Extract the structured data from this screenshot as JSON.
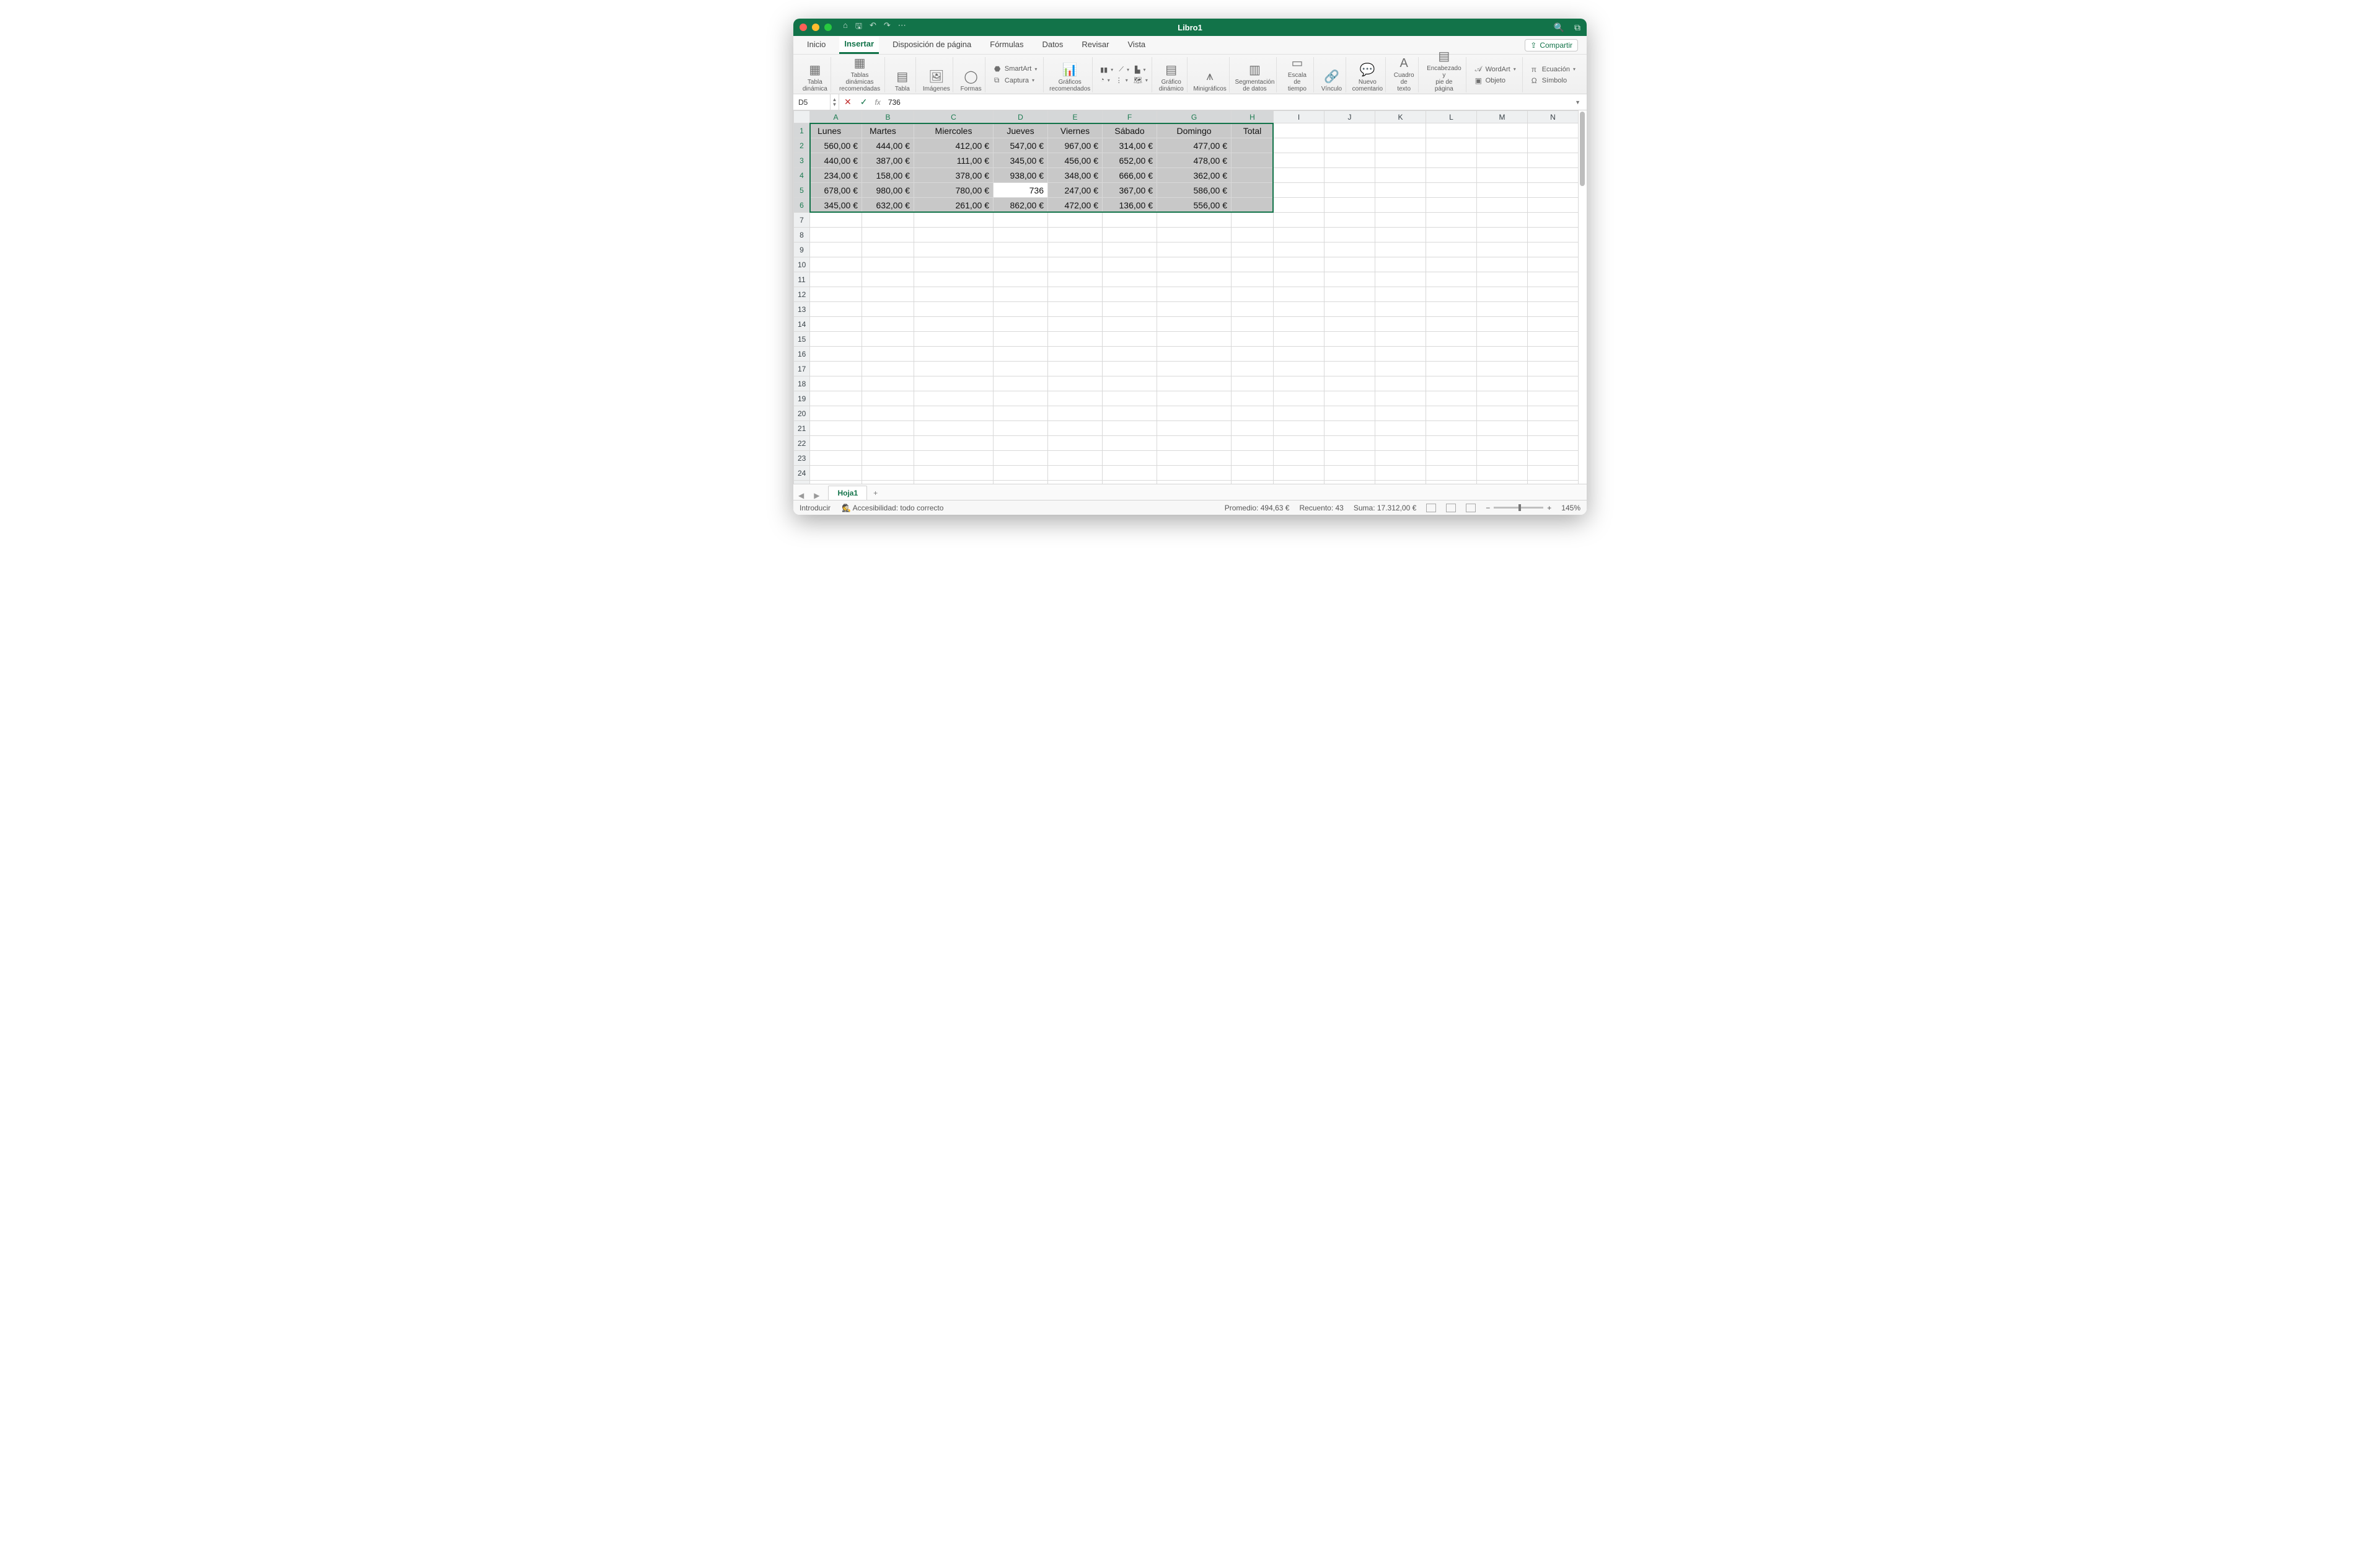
{
  "title": "Libro1",
  "menu": {
    "items": [
      "Inicio",
      "Insertar",
      "Disposición de página",
      "Fórmulas",
      "Datos",
      "Revisar",
      "Vista"
    ],
    "active": 1,
    "share": "Compartir"
  },
  "ribbon": {
    "tablaDinamica": "Tabla\ndinámica",
    "tablasRecomendadas": "Tablas dinámicas\nrecomendadas",
    "tabla": "Tabla",
    "imagenes": "Imágenes",
    "formas": "Formas",
    "smartart": "SmartArt",
    "captura": "Captura",
    "graficosRecomendados": "Gráficos\nrecomendados",
    "graficoDinamico": "Gráfico\ndinámico",
    "minigraficos": "Minigráficos",
    "segmentacion": "Segmentación\nde datos",
    "escalaTiempo": "Escala de\ntiempo",
    "vinculo": "Vínculo",
    "nuevoComentario": "Nuevo\ncomentario",
    "cuadroTexto": "Cuadro\nde texto",
    "encabezado": "Encabezado y\npie de página",
    "wordart": "WordArt",
    "objeto": "Objeto",
    "ecuacion": "Ecuación",
    "simbolo": "Símbolo"
  },
  "formulaBar": {
    "cellRef": "D5",
    "fx": "fx",
    "value": "736"
  },
  "columns": [
    "A",
    "B",
    "C",
    "D",
    "E",
    "F",
    "G",
    "H",
    "I",
    "J",
    "K",
    "L",
    "M",
    "N"
  ],
  "headerRow": [
    "Lunes",
    "Martes",
    "Miercoles",
    "Jueves",
    "Viernes",
    "Sábado",
    "Domingo",
    "Total"
  ],
  "rows": [
    [
      "560,00 €",
      "444,00 €",
      "412,00 €",
      "547,00 €",
      "967,00 €",
      "314,00 €",
      "477,00 €",
      ""
    ],
    [
      "440,00 €",
      "387,00 €",
      "111,00 €",
      "345,00 €",
      "456,00 €",
      "652,00 €",
      "478,00 €",
      ""
    ],
    [
      "234,00 €",
      "158,00 €",
      "378,00 €",
      "938,00 €",
      "348,00 €",
      "666,00 €",
      "362,00 €",
      ""
    ],
    [
      "678,00 €",
      "980,00 €",
      "780,00 €",
      "736",
      "247,00 €",
      "367,00 €",
      "586,00 €",
      ""
    ],
    [
      "345,00 €",
      "632,00 €",
      "261,00 €",
      "862,00 €",
      "472,00 €",
      "136,00 €",
      "556,00 €",
      ""
    ]
  ],
  "activeCell": {
    "row": 5,
    "col": "D"
  },
  "sheetTab": "Hoja1",
  "status": {
    "mode": "Introducir",
    "accessibility": "Accesibilidad: todo correcto",
    "avg": "Promedio: 494,63 €",
    "count": "Recuento: 43",
    "sum": "Suma: 17.312,00 €",
    "zoom": "145%"
  }
}
